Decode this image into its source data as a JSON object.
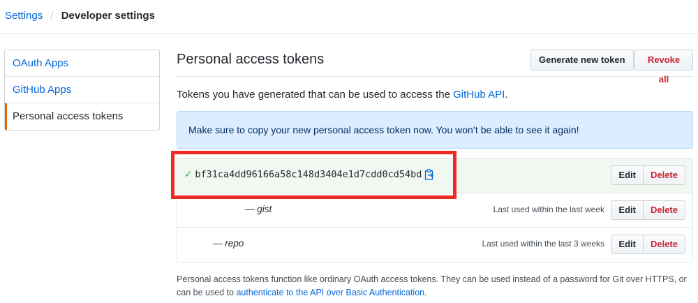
{
  "breadcrumb": {
    "parent": "Settings",
    "separator": "/",
    "current": "Developer settings"
  },
  "sidebar": {
    "items": [
      {
        "label": "OAuth Apps",
        "selected": false
      },
      {
        "label": "GitHub Apps",
        "selected": false
      },
      {
        "label": "Personal access tokens",
        "selected": true
      }
    ]
  },
  "main": {
    "title": "Personal access tokens",
    "generate_label": "Generate new token",
    "revoke_label": "Revoke all",
    "intro_prefix": "Tokens you have generated that can be used to access the ",
    "intro_link": "GitHub API",
    "intro_suffix": ".",
    "flash": "Make sure to copy your new personal access token now. You won’t be able to see it again!",
    "tokens": [
      {
        "value": "bf31ca4dd96166a58c148d3404e1d7cdd0cd54bd",
        "check": "✓"
      },
      {
        "scope": "— gist",
        "last_used": "Last used within the last week"
      },
      {
        "scope": "— repo",
        "last_used": "Last used within the last 3 weeks"
      }
    ],
    "edit_label": "Edit",
    "delete_label": "Delete",
    "footnote_text": "Personal access tokens function like ordinary OAuth access tokens. They can be used instead of a password for Git over HTTPS, or can be used to ",
    "footnote_link": "authenticate to the API over Basic Authentication",
    "footnote_end": "."
  },
  "colors": {
    "accent": "#0366d6",
    "selected_border": "#e36209",
    "danger": "#cb2431",
    "flash_bg": "#dbedff",
    "new_token_bg": "#f1f8f1",
    "highlight": "#ee2a24"
  },
  "icons": {
    "check": "check-icon",
    "clipboard": "clipboard-icon"
  }
}
